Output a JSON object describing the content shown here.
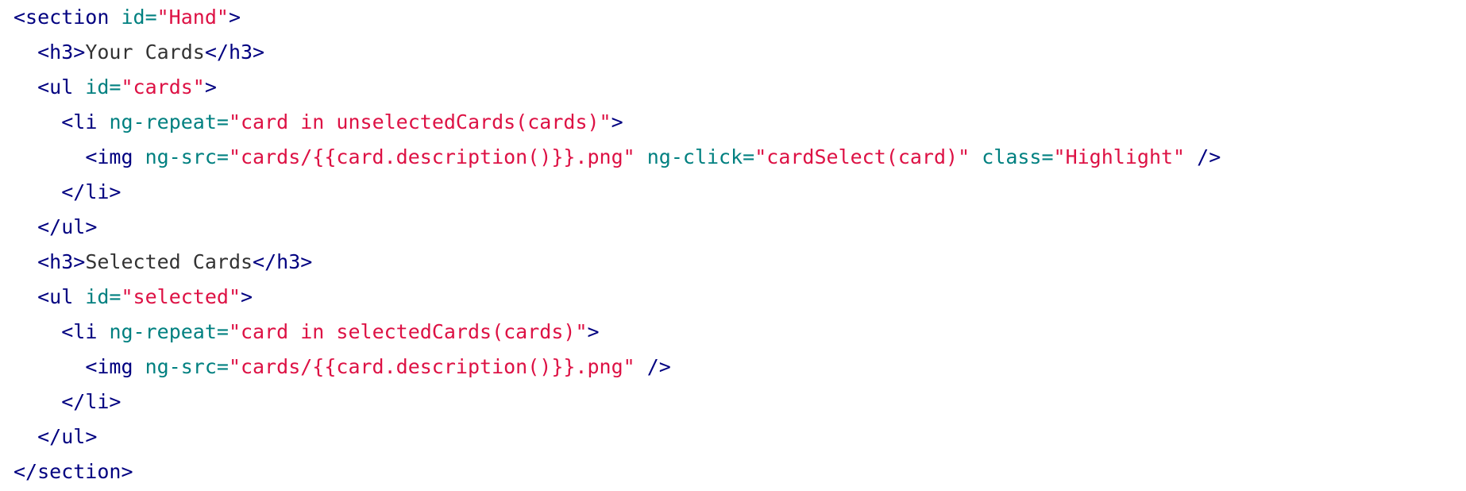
{
  "colors": {
    "background": "#ffffff",
    "tag": "#000080",
    "attribute": "#008080",
    "string": "#dd1144",
    "text": "#333333"
  },
  "code_lines": [
    [
      {
        "t": "tag",
        "v": "<section "
      },
      {
        "t": "attr",
        "v": "id="
      },
      {
        "t": "str",
        "v": "\"Hand\""
      },
      {
        "t": "tag",
        "v": ">"
      }
    ],
    [
      {
        "t": "txt",
        "v": "  "
      },
      {
        "t": "tag",
        "v": "<h3>"
      },
      {
        "t": "txt",
        "v": "Your Cards"
      },
      {
        "t": "tag",
        "v": "</h3>"
      }
    ],
    [
      {
        "t": "txt",
        "v": "  "
      },
      {
        "t": "tag",
        "v": "<ul "
      },
      {
        "t": "attr",
        "v": "id="
      },
      {
        "t": "str",
        "v": "\"cards\""
      },
      {
        "t": "tag",
        "v": ">"
      }
    ],
    [
      {
        "t": "txt",
        "v": "    "
      },
      {
        "t": "tag",
        "v": "<li "
      },
      {
        "t": "attr",
        "v": "ng-repeat="
      },
      {
        "t": "str",
        "v": "\"card in unselectedCards(cards)\""
      },
      {
        "t": "tag",
        "v": ">"
      }
    ],
    [
      {
        "t": "txt",
        "v": "      "
      },
      {
        "t": "tag",
        "v": "<img "
      },
      {
        "t": "attr",
        "v": "ng-src="
      },
      {
        "t": "str",
        "v": "\"cards/{{card.description()}}.png\""
      },
      {
        "t": "txt",
        "v": " "
      },
      {
        "t": "attr",
        "v": "ng-click="
      },
      {
        "t": "str",
        "v": "\"cardSelect(card)\""
      },
      {
        "t": "txt",
        "v": " "
      },
      {
        "t": "attr",
        "v": "class="
      },
      {
        "t": "str",
        "v": "\"Highlight\""
      },
      {
        "t": "txt",
        "v": " "
      },
      {
        "t": "tag",
        "v": "/>"
      }
    ],
    [
      {
        "t": "txt",
        "v": "    "
      },
      {
        "t": "tag",
        "v": "</li>"
      }
    ],
    [
      {
        "t": "txt",
        "v": "  "
      },
      {
        "t": "tag",
        "v": "</ul>"
      }
    ],
    [
      {
        "t": "txt",
        "v": "  "
      },
      {
        "t": "tag",
        "v": "<h3>"
      },
      {
        "t": "txt",
        "v": "Selected Cards"
      },
      {
        "t": "tag",
        "v": "</h3>"
      }
    ],
    [
      {
        "t": "txt",
        "v": "  "
      },
      {
        "t": "tag",
        "v": "<ul "
      },
      {
        "t": "attr",
        "v": "id="
      },
      {
        "t": "str",
        "v": "\"selected\""
      },
      {
        "t": "tag",
        "v": ">"
      }
    ],
    [
      {
        "t": "txt",
        "v": "    "
      },
      {
        "t": "tag",
        "v": "<li "
      },
      {
        "t": "attr",
        "v": "ng-repeat="
      },
      {
        "t": "str",
        "v": "\"card in selectedCards(cards)\""
      },
      {
        "t": "tag",
        "v": ">"
      }
    ],
    [
      {
        "t": "txt",
        "v": "      "
      },
      {
        "t": "tag",
        "v": "<img "
      },
      {
        "t": "attr",
        "v": "ng-src="
      },
      {
        "t": "str",
        "v": "\"cards/{{card.description()}}.png\""
      },
      {
        "t": "txt",
        "v": " "
      },
      {
        "t": "tag",
        "v": "/>"
      }
    ],
    [
      {
        "t": "txt",
        "v": "    "
      },
      {
        "t": "tag",
        "v": "</li>"
      }
    ],
    [
      {
        "t": "txt",
        "v": "  "
      },
      {
        "t": "tag",
        "v": "</ul>"
      }
    ],
    [
      {
        "t": "tag",
        "v": "</section>"
      }
    ]
  ]
}
